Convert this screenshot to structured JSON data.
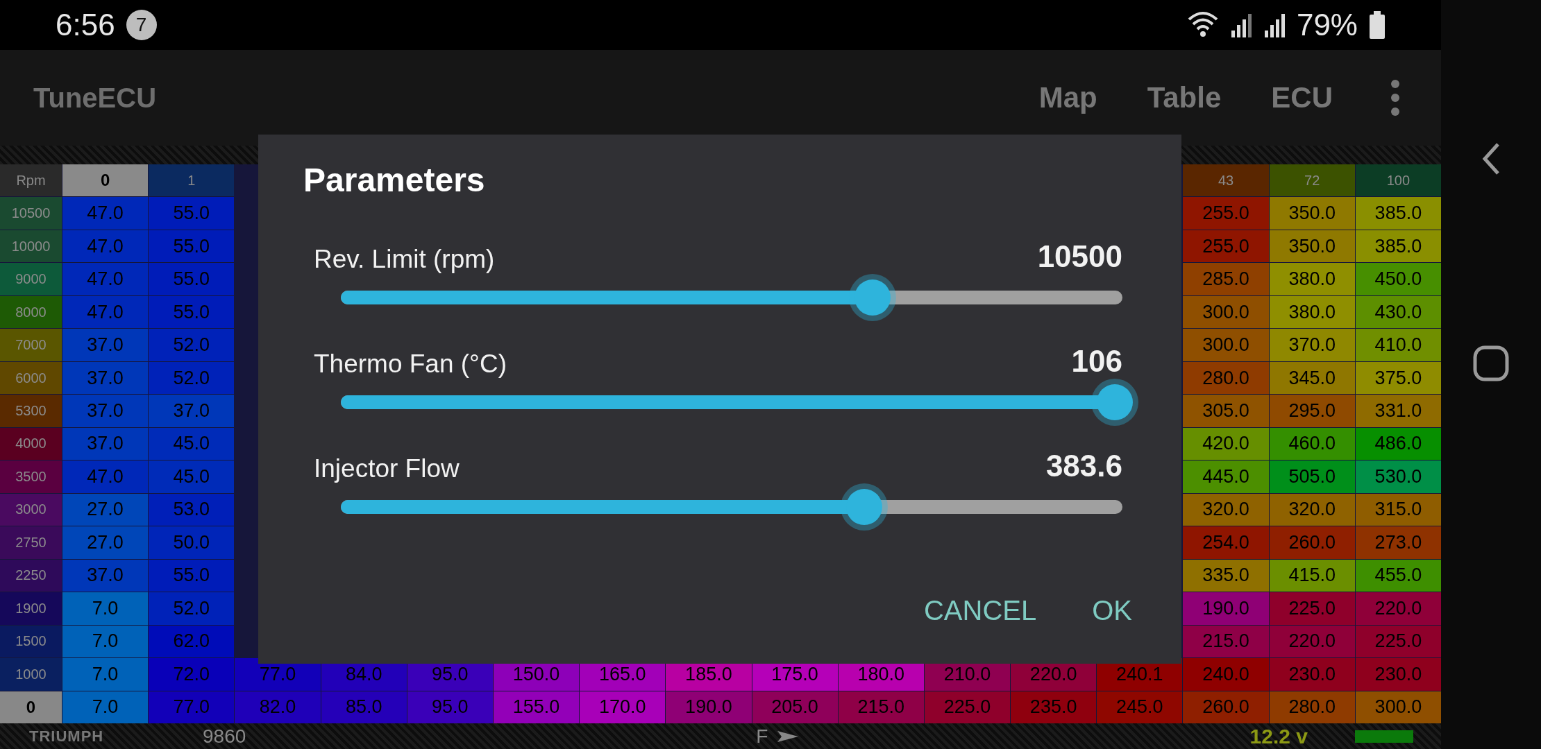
{
  "status_bar": {
    "time": "6:56",
    "notification_count": "7",
    "battery": "79%"
  },
  "app_bar": {
    "title": "TuneECU",
    "actions": [
      "Map",
      "Table",
      "ECU"
    ]
  },
  "table": {
    "corner": "Rpm",
    "columns": [
      {
        "label": "0",
        "selected": true
      },
      {
        "label": "1",
        "selected": false,
        "color": "#0b2a60"
      },
      null,
      null,
      null,
      null,
      null,
      null,
      null,
      null,
      null,
      null,
      null,
      {
        "label": "43",
        "selected": false,
        "color": "#5a2600"
      },
      {
        "label": "72",
        "selected": false,
        "color": "#3c5200"
      },
      {
        "label": "100",
        "selected": false,
        "color": "#0c3d25"
      }
    ],
    "rows": [
      {
        "rpm": "10500",
        "selected": false,
        "color": "#1a4a30",
        "cells": [
          "47.0",
          "55.0",
          null,
          null,
          null,
          null,
          null,
          null,
          null,
          null,
          null,
          null,
          null,
          "255.0",
          "350.0",
          "385.0"
        ]
      },
      {
        "rpm": "10000",
        "selected": false,
        "color": "#1a4a30",
        "cells": [
          "47.0",
          "55.0",
          null,
          null,
          null,
          null,
          null,
          null,
          null,
          null,
          null,
          null,
          null,
          "255.0",
          "350.0",
          "385.0"
        ]
      },
      {
        "rpm": "9000",
        "selected": false,
        "color": "#0d5a3a",
        "cells": [
          "47.0",
          "55.0",
          null,
          null,
          null,
          null,
          null,
          null,
          null,
          null,
          null,
          null,
          null,
          "285.0",
          "380.0",
          "450.0"
        ]
      },
      {
        "rpm": "8000",
        "selected": false,
        "color": "#1e5a05",
        "cells": [
          "47.0",
          "55.0",
          null,
          null,
          null,
          null,
          null,
          null,
          null,
          null,
          null,
          null,
          null,
          "300.0",
          "380.0",
          "430.0"
        ]
      },
      {
        "rpm": "7000",
        "selected": false,
        "color": "#5a5600",
        "cells": [
          "37.0",
          "52.0",
          null,
          null,
          null,
          null,
          null,
          null,
          null,
          null,
          null,
          null,
          null,
          "300.0",
          "370.0",
          "410.0"
        ]
      },
      {
        "rpm": "6000",
        "selected": false,
        "color": "#604800",
        "cells": [
          "37.0",
          "52.0",
          null,
          null,
          null,
          null,
          null,
          null,
          null,
          null,
          null,
          null,
          null,
          "280.0",
          "345.0",
          "375.0"
        ]
      },
      {
        "rpm": "5300",
        "selected": false,
        "color": "#5a2a00",
        "cells": [
          "37.0",
          "37.0",
          null,
          null,
          null,
          null,
          null,
          null,
          null,
          null,
          null,
          null,
          null,
          "305.0",
          "295.0",
          "331.0"
        ]
      },
      {
        "rpm": "4000",
        "selected": false,
        "color": "#5a0020",
        "cells": [
          "37.0",
          "45.0",
          null,
          null,
          null,
          null,
          null,
          null,
          null,
          null,
          null,
          null,
          null,
          "420.0",
          "460.0",
          "486.0"
        ]
      },
      {
        "rpm": "3500",
        "selected": false,
        "color": "#5a0040",
        "cells": [
          "47.0",
          "45.0",
          null,
          null,
          null,
          null,
          null,
          null,
          null,
          null,
          null,
          null,
          null,
          "445.0",
          "505.0",
          "530.0"
        ]
      },
      {
        "rpm": "3000",
        "selected": false,
        "color": "#4a0a60",
        "cells": [
          "27.0",
          "53.0",
          null,
          null,
          null,
          null,
          null,
          null,
          null,
          null,
          null,
          null,
          null,
          "320.0",
          "320.0",
          "315.0"
        ]
      },
      {
        "rpm": "2750",
        "selected": false,
        "color": "#3a0a5a",
        "cells": [
          "27.0",
          "50.0",
          null,
          null,
          null,
          null,
          null,
          null,
          null,
          null,
          null,
          null,
          null,
          "254.0",
          "260.0",
          "273.0"
        ]
      },
      {
        "rpm": "2250",
        "selected": false,
        "color": "#2e0a5a",
        "cells": [
          "37.0",
          "55.0",
          null,
          null,
          null,
          null,
          null,
          null,
          null,
          null,
          null,
          null,
          null,
          "335.0",
          "415.0",
          "455.0"
        ]
      },
      {
        "rpm": "1900",
        "selected": false,
        "color": "#15085a",
        "cells": [
          "7.0",
          "52.0",
          null,
          null,
          null,
          null,
          null,
          null,
          null,
          null,
          null,
          null,
          null,
          "190.0",
          "225.0",
          "220.0"
        ]
      },
      {
        "rpm": "1500",
        "selected": false,
        "color": "#0a1a60",
        "cells": [
          "7.0",
          "62.0",
          null,
          null,
          null,
          null,
          null,
          null,
          null,
          null,
          null,
          null,
          null,
          "215.0",
          "220.0",
          "225.0"
        ]
      },
      {
        "rpm": "1000",
        "selected": false,
        "color": "#0a2060",
        "cells": [
          "7.0",
          "72.0",
          "77.0",
          "84.0",
          "95.0",
          "150.0",
          "165.0",
          "185.0",
          "175.0",
          "180.0",
          "210.0",
          "220.0",
          "240.1",
          "240.0",
          "230.0",
          "230.0"
        ]
      },
      {
        "rpm": "0",
        "selected": true,
        "color": "#888888",
        "cells": [
          "7.0",
          "77.0",
          "82.0",
          "85.0",
          "95.0",
          "155.0",
          "170.0",
          "190.0",
          "205.0",
          "215.0",
          "225.0",
          "235.0",
          "245.0",
          "260.0",
          "280.0",
          "300.0"
        ]
      }
    ]
  },
  "bottom_bar": {
    "brand": "TRIUMPH",
    "rpm": "9860",
    "gear": "F",
    "voltage": "12.2 v"
  },
  "dialog": {
    "title": "Parameters",
    "sliders": [
      {
        "label": "Rev. Limit (rpm)",
        "value": "10500",
        "level": 0.68
      },
      {
        "label": "Thermo Fan (°C)",
        "value": "106",
        "level": 0.99
      },
      {
        "label": "Injector Flow",
        "value": "383.6",
        "level": 0.67
      }
    ],
    "buttons": [
      "CANCEL",
      "OK"
    ]
  }
}
